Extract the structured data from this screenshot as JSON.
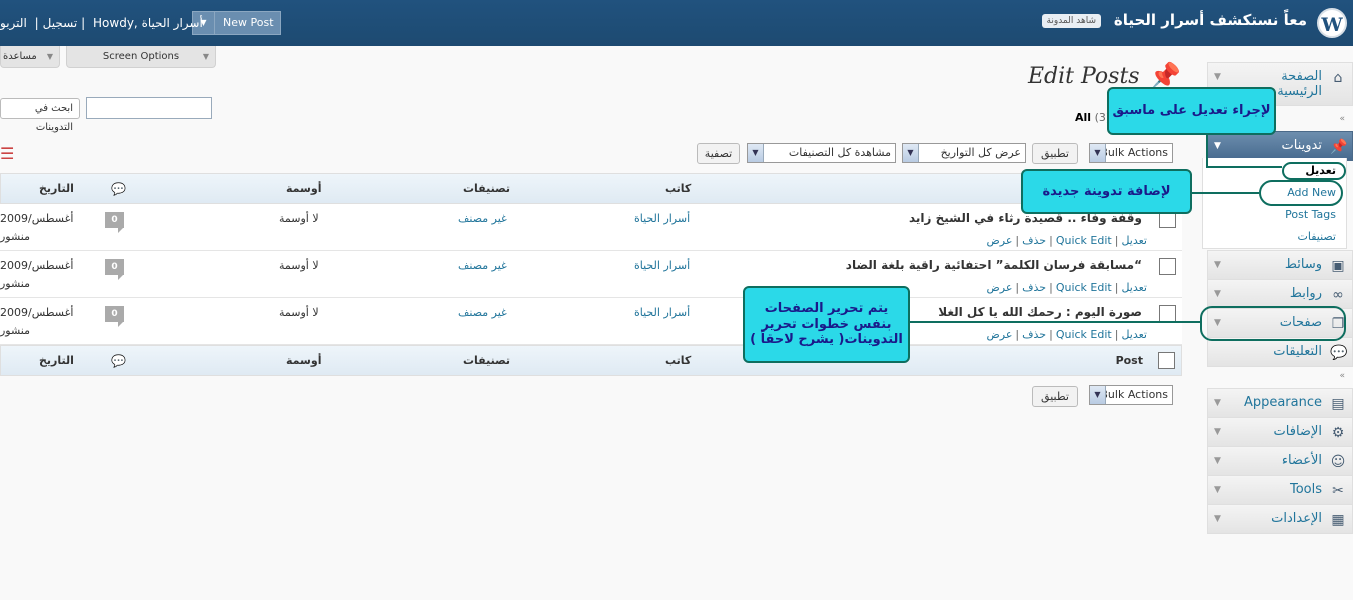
{
  "header": {
    "logo": "W",
    "site_title": "معاً نستكشف أسرار الحياة",
    "visit_site": "شاهد المدونة",
    "new_post": "New Post",
    "howdy": "Howdy, أسرار الحياة",
    "turbo": "التربو",
    "logout": "تسجيل"
  },
  "toolbar": {
    "screen_options": "Screen Options",
    "help": "مساعدة",
    "search_button": "ابحث في التدوينات"
  },
  "page": {
    "title": "Edit Posts",
    "filter_all": "All",
    "filter_count": "(3)"
  },
  "filters": {
    "bulk_actions": "Bulk Actions",
    "apply": "تطبيق",
    "dates": "عرض كل التواريخ",
    "categories": "مشاهدة كل التصنيفات",
    "filter_button": "تصفية"
  },
  "table": {
    "headers": {
      "post": "Post",
      "author": "كاتب",
      "categories": "تصنيفات",
      "tags": "أوسمة",
      "date": "التاريخ"
    },
    "rows": [
      {
        "title": "وقفة وفاء .. قصيدة رثاء في الشيخ زايد",
        "author": "أسرار الحياة",
        "category": "غير مصنف",
        "tags": "لا أوسمة",
        "comments": "0",
        "date": "2009/أغسطس",
        "status": "منشور"
      },
      {
        "title": "“مسابقة فرسان الكلمة” احتفائية راقية بلغة الضاد",
        "author": "أسرار الحياة",
        "category": "غير مصنف",
        "tags": "لا أوسمة",
        "comments": "0",
        "date": "2009/أغسطس",
        "status": "منشور"
      },
      {
        "title": "صورة اليوم : رحمك الله يا كل الغلا",
        "author": "أسرار الحياة",
        "category": "غير مصنف",
        "tags": "لا أوسمة",
        "comments": "0",
        "date": "2009/أغسطس",
        "status": "منشور"
      }
    ],
    "row_actions": {
      "edit": "تعديل",
      "quick_edit": "Quick Edit",
      "delete": "حذف",
      "view": "عرض"
    }
  },
  "menu": {
    "dashboard": "الصفحة الرئيسية",
    "posts": "تدوينات",
    "posts_sub": [
      "تعديل",
      "Add New",
      "Post Tags",
      "تصنيفات"
    ],
    "media": "وسائط",
    "links": "روابط",
    "pages": "صفحات",
    "comments": "التعليقات",
    "appearance": "Appearance",
    "plugins": "الإضافات",
    "users": "الأعضاء",
    "tools": "Tools",
    "settings": "الإعدادات"
  },
  "annotations": {
    "edit_existing": "لإجراء تعديل على ماسبق",
    "add_new": "لإضافة تدوينة جديدة",
    "pages_note": "يتم تحرير الصفحات بنفس خطوات تحرير التدوينات( يشرح لاحقاً )"
  },
  "colors": {
    "header": "#21527e",
    "link": "#21759b",
    "callout": "#2bd9e8",
    "callout_border": "#0e6e5f"
  }
}
